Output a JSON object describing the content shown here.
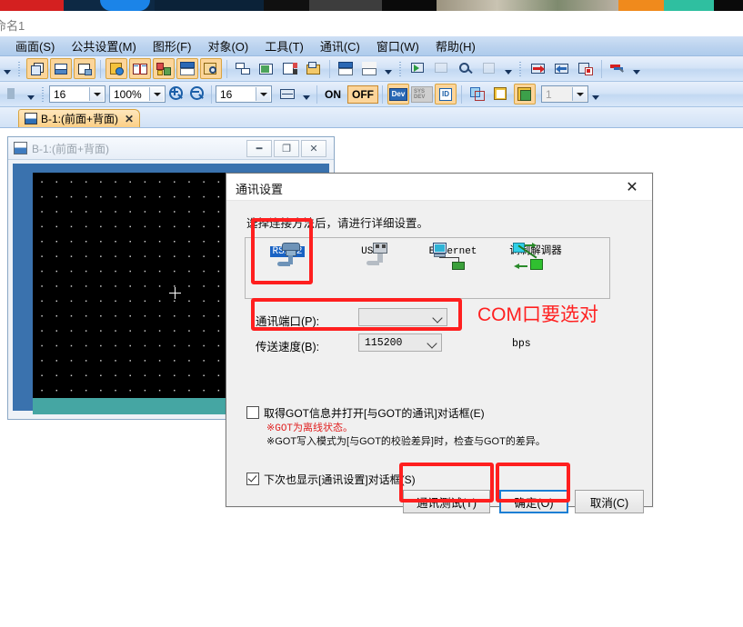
{
  "app": {
    "title": "命名1"
  },
  "menubar": {
    "items": [
      {
        "label": "画面(S)",
        "name": "menu-screen"
      },
      {
        "label": "公共设置(M)",
        "name": "menu-common"
      },
      {
        "label": "图形(F)",
        "name": "menu-figure"
      },
      {
        "label": "对象(O)",
        "name": "menu-object"
      },
      {
        "label": "工具(T)",
        "name": "menu-tool"
      },
      {
        "label": "通讯(C)",
        "name": "menu-comm"
      },
      {
        "label": "窗口(W)",
        "name": "menu-window"
      },
      {
        "label": "帮助(H)",
        "name": "menu-help"
      }
    ]
  },
  "toolbar2": {
    "font_size": "16",
    "zoom_level": "100%",
    "grid_size": "16",
    "on_label": "ON",
    "off_label": "OFF",
    "dev_label": "Dev",
    "sysdev_label": "SYS DEV",
    "id_label": "ID",
    "layer_value": "1"
  },
  "tab": {
    "label": "B-1:(前面+背面)",
    "close": "✕"
  },
  "mdi": {
    "title": "B-1:(前面+背面)",
    "minimize": "━",
    "maximize": "❐",
    "close": "✕"
  },
  "dialog": {
    "title": "通讯设置",
    "close": "✕",
    "hint": "选择连接方法后，请进行详细设置。",
    "connections": [
      {
        "label": "RS232",
        "name": "conn-rs232",
        "selected": true
      },
      {
        "label": "USB",
        "name": "conn-usb",
        "selected": false
      },
      {
        "label": "Ethernet",
        "name": "conn-ethernet",
        "selected": false
      },
      {
        "label": "调制解调器",
        "name": "conn-modem",
        "selected": false
      }
    ],
    "port_label": "通讯端口(P):",
    "port_value": "",
    "speed_label": "传送速度(B):",
    "speed_value": "115200",
    "speed_unit": "bps",
    "checkbox_got": {
      "label": "取得GOT信息并打开[与GOT的通讯]对话框(E)",
      "checked": false
    },
    "note_red": "※GOT为离线状态。",
    "note_black": "※GOT写入模式为[与GOT的校验差异]时，检查与GOT的差异。",
    "checkbox_show_next": {
      "label": "下次也显示[通讯设置]对话框(S)",
      "checked": true
    },
    "buttons": {
      "test": "通讯测试(T)",
      "ok": "确定(O)",
      "cancel": "取消(C)"
    }
  },
  "annotation": {
    "text": "COM口要选对",
    "color": "#ff2020"
  },
  "colors": {
    "highlight_red": "#ff1f1f",
    "selection_blue": "#1a63c4",
    "focus_blue": "#1a7fd4",
    "canvas_black": "#000000",
    "canvas_accent": "#45a6a3",
    "toolbar_highlight": "#fcd59a"
  }
}
